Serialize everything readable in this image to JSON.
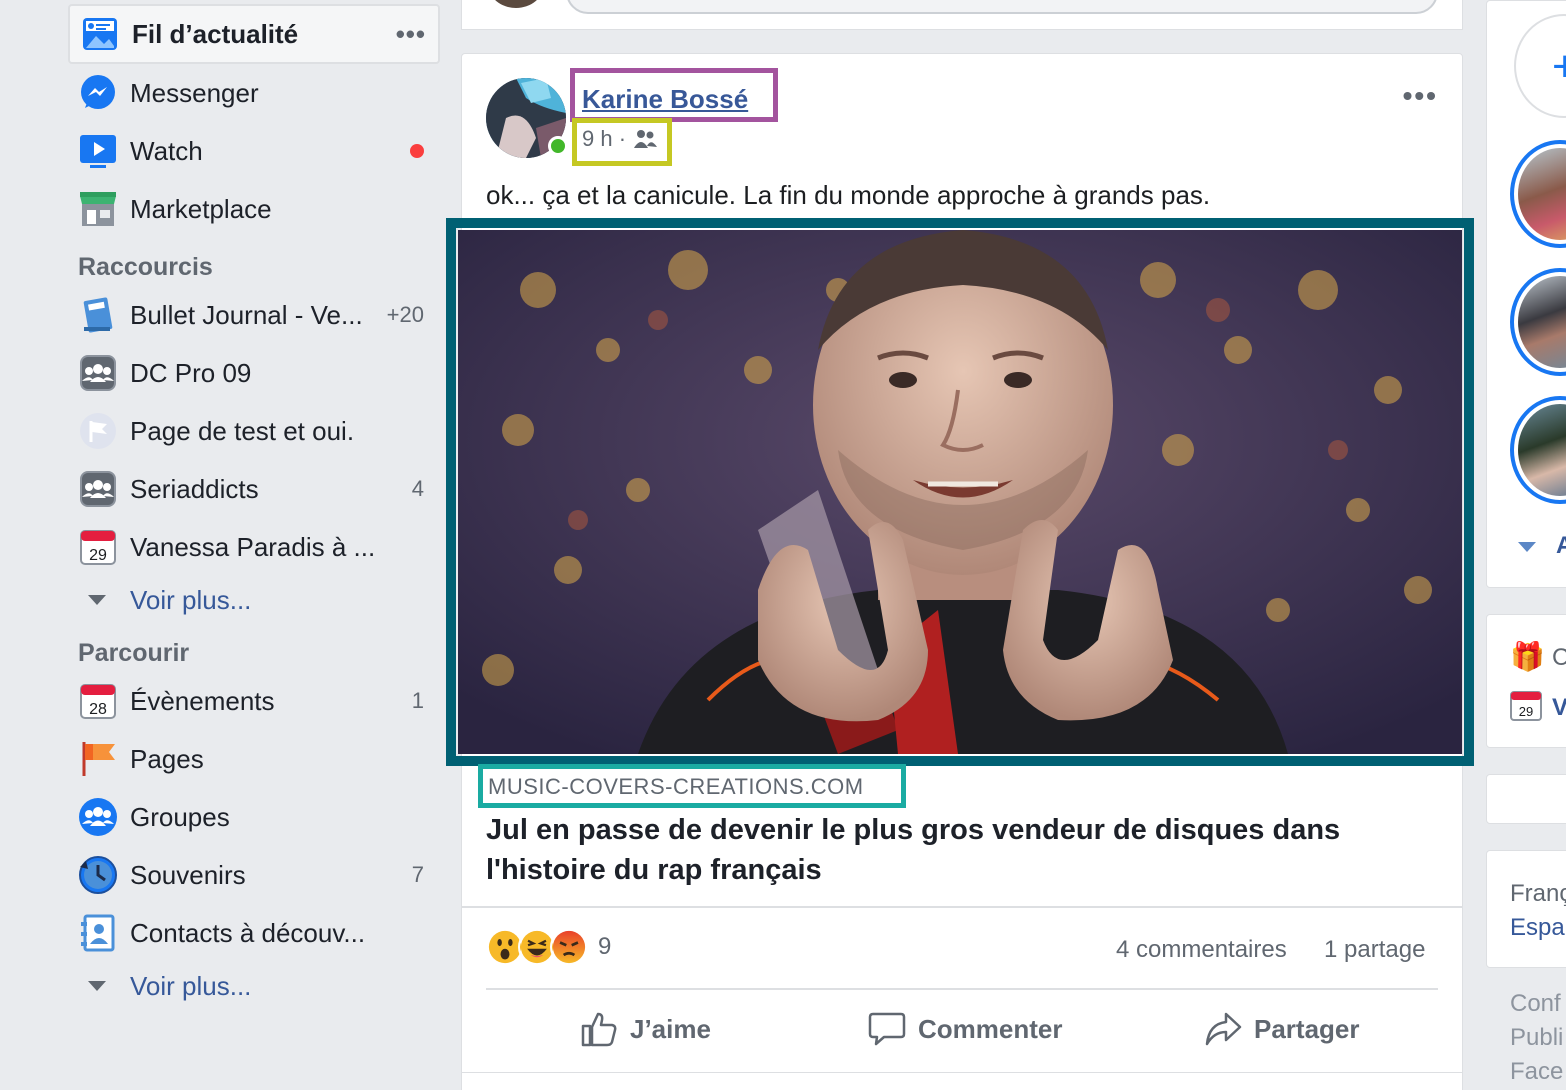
{
  "sidebar": {
    "main": [
      {
        "label": "Fil d’actualité",
        "icon": "news-feed-icon",
        "more": "•••"
      },
      {
        "label": "Messenger",
        "icon": "messenger-icon"
      },
      {
        "label": "Watch",
        "icon": "watch-icon"
      },
      {
        "label": "Marketplace",
        "icon": "marketplace-icon"
      }
    ],
    "shortcuts_title": "Raccourcis",
    "shortcuts": [
      {
        "label": "Bullet Journal - Ve...",
        "count": "+20",
        "icon": "notebook-icon"
      },
      {
        "label": "DC Pro 09",
        "count": "",
        "icon": "group-icon"
      },
      {
        "label": "Page de test et oui.",
        "count": "",
        "icon": "flag-icon"
      },
      {
        "label": "Seriaddicts",
        "count": "4",
        "icon": "group-icon"
      },
      {
        "label": "Vanessa Paradis à ...",
        "count": "",
        "icon": "calendar-icon",
        "day": "29"
      }
    ],
    "shortcuts_more": "Voir plus...",
    "browse_title": "Parcourir",
    "browse": [
      {
        "label": "Évènements",
        "count": "1",
        "icon": "calendar-icon",
        "day": "28"
      },
      {
        "label": "Pages",
        "count": "",
        "icon": "pages-flag-icon"
      },
      {
        "label": "Groupes",
        "count": "",
        "icon": "groups-icon"
      },
      {
        "label": "Souvenirs",
        "count": "7",
        "icon": "memories-clock-icon"
      },
      {
        "label": "Contacts à découv...",
        "count": "",
        "icon": "contacts-icon"
      }
    ],
    "browse_more": "Voir plus..."
  },
  "post": {
    "author": "Karine Bossé",
    "time": "9 h ·",
    "audience_icon": "friends-icon",
    "menu": "•••",
    "text": "ok... ça et la canicule. La fin du monde approche à grands pas.",
    "link_domain": "MUSIC-COVERS-CREATIONS.COM",
    "link_title": "Jul en passe de devenir le plus gros vendeur de disques dans l'histoire du rap français",
    "reaction_count": "9",
    "comments": "4 commentaires",
    "shares": "1 partage",
    "actions": {
      "like": "J’aime",
      "comment": "Commenter",
      "share": "Partager"
    }
  },
  "right": {
    "story_add": "+",
    "see_all_letter": "A",
    "birthday_letter": "C",
    "event_letter": "V",
    "event_day": "29",
    "lang1": "Franç",
    "lang2": "Espa",
    "footer1": "Conf",
    "footer2": "Publi",
    "footer3": "Face"
  },
  "colors": {
    "author_highlight": "#a3549e",
    "time_highlight": "#c5c823",
    "image_frame": "#006073",
    "domain_highlight": "#1aaba2",
    "link": "#365899",
    "online": "#42b72a"
  }
}
